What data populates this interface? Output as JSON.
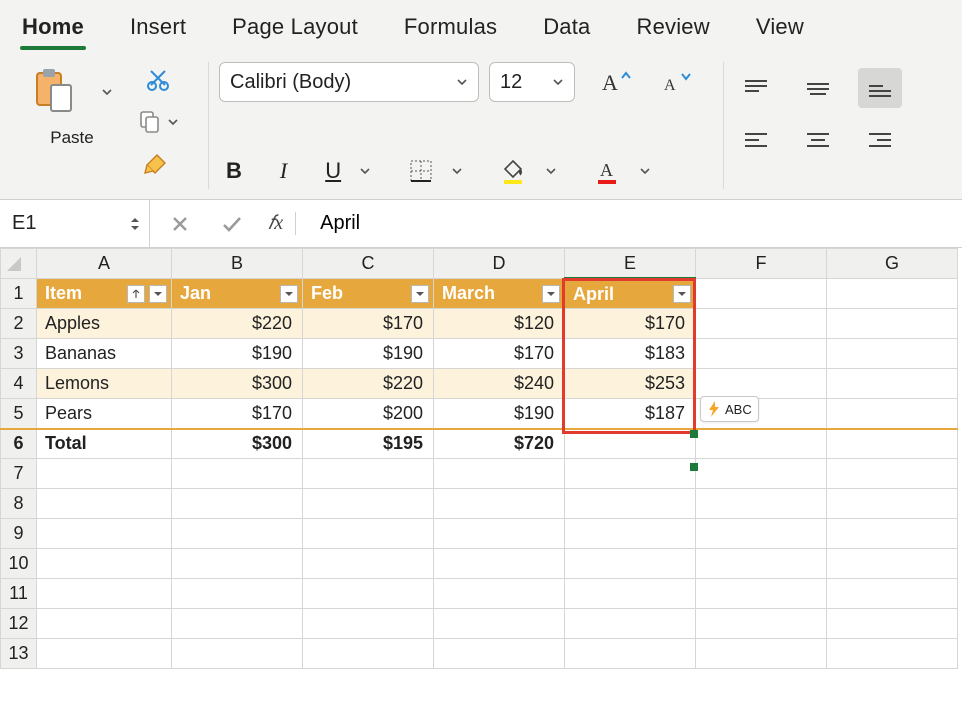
{
  "tabs": {
    "items": [
      "Home",
      "Insert",
      "Page Layout",
      "Formulas",
      "Data",
      "Review",
      "View"
    ],
    "active": 0
  },
  "ribbon": {
    "paste_label": "Paste",
    "font_name": "Calibri (Body)",
    "font_size": "12",
    "bold": "B",
    "italic": "I",
    "underline": "U"
  },
  "formula_bar": {
    "name_box": "E1",
    "formula": "April"
  },
  "grid": {
    "columns": [
      "A",
      "B",
      "C",
      "D",
      "E",
      "F",
      "G"
    ],
    "selected_col_index": 4,
    "headers": [
      "Item",
      "Jan",
      "Feb",
      "March",
      "April"
    ],
    "rows": [
      {
        "item": "Apples",
        "jan": "$220",
        "feb": "$170",
        "mar": "$120",
        "apr": "$170"
      },
      {
        "item": "Bananas",
        "jan": "$190",
        "feb": "$190",
        "mar": "$170",
        "apr": "$183"
      },
      {
        "item": "Lemons",
        "jan": "$300",
        "feb": "$220",
        "mar": "$240",
        "apr": "$253"
      },
      {
        "item": "Pears",
        "jan": "$170",
        "feb": "$200",
        "mar": "$190",
        "apr": "$187"
      }
    ],
    "total": {
      "label": "Total",
      "jan": "$300",
      "feb": "$195",
      "mar": "$720"
    },
    "flashfill_hint": "ABC"
  },
  "colors": {
    "accent_green": "#1d7a3a",
    "table_header": "#e6a73d",
    "highlight_red": "#e23b2e",
    "fill_yellow": "#ffe81a",
    "font_red": "#e81a1a"
  }
}
